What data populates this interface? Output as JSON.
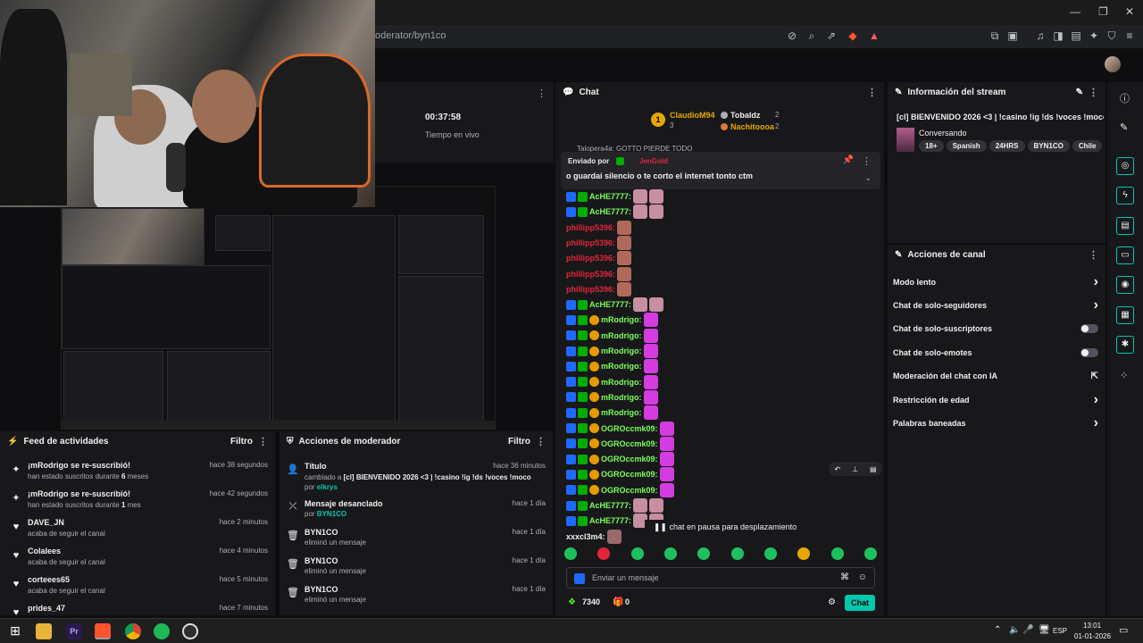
{
  "browser": {
    "url": "oderator/byn1co"
  },
  "stats": {
    "uptime": "00:37:58",
    "uptime_label": "Tiempo en vivo"
  },
  "feed": {
    "title": "Feed de actividades",
    "filter": "Filtro",
    "items": [
      {
        "title": "¡mRodrigo se re-suscribió!",
        "sub_pre": "han estado suscritos durante ",
        "sub_num": "6",
        "sub_post": " meses",
        "time": "hace 38 segundos"
      },
      {
        "title": "¡mRodrigo se re-suscribió!",
        "sub_pre": "han estado suscritos durante ",
        "sub_num": "1",
        "sub_post": " mes",
        "time": "hace 42 segundos"
      },
      {
        "title": "DAVE_JN",
        "sub": "acaba de seguir el canal",
        "time": "hace 2 minutos"
      },
      {
        "title": "Colalees",
        "sub": "acaba de seguir el canal",
        "time": "hace 4 minutos"
      },
      {
        "title": "corteees65",
        "sub": "acaba de seguir el canal",
        "time": "hace 5 minutos"
      },
      {
        "title": "prides_47",
        "time": "hace 7 minutos"
      }
    ]
  },
  "modactions": {
    "title": "Acciones de moderador",
    "filter": "Filtro",
    "items": [
      {
        "title": "Título",
        "sub_pre": "cambiado a ",
        "sub_val": "[cl] BIENVENIDO 2026 <3 | !casino !ig !ds !voces !moco",
        "sub_mid": " por ",
        "sub_user": "elkrys",
        "time": "hace 36 minutos"
      },
      {
        "title": "Mensaje desanclado",
        "sub_pre": "por ",
        "sub_user": "BYN1CO",
        "time": "hace 1 día"
      },
      {
        "title": "BYN1CO",
        "sub": "eliminó un mensaje",
        "time": "hace 1 día"
      },
      {
        "title": "BYN1CO",
        "sub": "eliminó un mensaje",
        "time": "hace 1 día"
      },
      {
        "title": "BYN1CO",
        "sub": "eliminó un mensaje",
        "time": "hace 1 día"
      }
    ]
  },
  "chat": {
    "title": "Chat",
    "leaders": [
      {
        "rank": "1",
        "name": "ClaudioM94",
        "count": "3"
      },
      {
        "name": "Tobaldz",
        "count": "2"
      },
      {
        "name": "Nachitoooa",
        "count": "2"
      }
    ],
    "pinned": {
      "label": "Enviado por",
      "user": "JenGold",
      "text": "o guardai silencio o te corto el internet tonto ctm"
    },
    "partial_top": "Talopera4a: GOTTO PIERDE TODO",
    "messages": [
      {
        "user": "AcHE7777:",
        "color": "#7cff5a",
        "type": "ache"
      },
      {
        "user": "AcHE7777:",
        "color": "#7cff5a",
        "type": "ache"
      },
      {
        "user": "phillipp5396:",
        "color": "#e3253b",
        "type": "phil"
      },
      {
        "user": "phillipp5396:",
        "color": "#e3253b",
        "type": "phil"
      },
      {
        "user": "phillipp5396:",
        "color": "#e3253b",
        "type": "phil"
      },
      {
        "user": "phillipp5396:",
        "color": "#e3253b",
        "type": "phil"
      },
      {
        "user": "phillipp5396:",
        "color": "#e3253b",
        "type": "phil"
      },
      {
        "user": "AcHE7777:",
        "color": "#7cff5a",
        "type": "ache"
      },
      {
        "user": "mRodrigo:",
        "color": "#7cff5a",
        "type": "mrod"
      },
      {
        "user": "mRodrigo:",
        "color": "#7cff5a",
        "type": "mrod"
      },
      {
        "user": "mRodrigo:",
        "color": "#7cff5a",
        "type": "mrod"
      },
      {
        "user": "mRodrigo:",
        "color": "#7cff5a",
        "type": "mrod"
      },
      {
        "user": "mRodrigo:",
        "color": "#7cff5a",
        "type": "mrod"
      },
      {
        "user": "mRodrigo:",
        "color": "#7cff5a",
        "type": "mrod"
      },
      {
        "user": "mRodrigo:",
        "color": "#7cff5a",
        "type": "mrod"
      },
      {
        "user": "OGROccmk09:",
        "color": "#7cff5a",
        "type": "ogro"
      },
      {
        "user": "OGROccmk09:",
        "color": "#7cff5a",
        "type": "ogro"
      },
      {
        "user": "OGROccmk09:",
        "color": "#7cff5a",
        "type": "ogro"
      },
      {
        "user": "OGROccmk09:",
        "color": "#7cff5a",
        "type": "ogro"
      },
      {
        "user": "OGROccmk09:",
        "color": "#7cff5a",
        "type": "ogro"
      },
      {
        "user": "AcHE7777:",
        "color": "#7cff5a",
        "type": "ache"
      },
      {
        "user": "AcHE7777:",
        "color": "#7cff5a",
        "type": "ache"
      },
      {
        "user": "xxxcl3m4:",
        "color": "#efeff1",
        "type": "plain"
      }
    ],
    "paused": "chat en pausa para desplazamiento",
    "input_placeholder": "Enviar un mensaje",
    "points": "7340",
    "gifts": "0",
    "send": "Chat"
  },
  "info": {
    "title": "Información del stream",
    "stream_title": "[cl] BIENVENIDO 2026 <3 | !casino !ig !ds !voces !moco",
    "category": "Conversando",
    "tags": [
      "18+",
      "Spanish",
      "24HRS",
      "BYN1CO",
      "Chile",
      "Esp"
    ]
  },
  "channel": {
    "title": "Acciones de canal",
    "actions": [
      {
        "label": "Modo lento",
        "control": "arrow"
      },
      {
        "label": "Chat de solo-seguidores",
        "control": "arrow"
      },
      {
        "label": "Chat de solo-suscriptores",
        "control": "toggle"
      },
      {
        "label": "Chat de solo-emotes",
        "control": "toggle"
      },
      {
        "label": "Moderación del chat con IA",
        "control": "external"
      },
      {
        "label": "Restricción de edad",
        "control": "arrow"
      },
      {
        "label": "Palabras baneadas",
        "control": "arrow"
      }
    ]
  },
  "taskbar": {
    "lang": "ESP",
    "time": "13:01",
    "date": "01-01-2026"
  },
  "colors": {
    "accent": "#00c8af",
    "kick_green": "#53fc18"
  }
}
